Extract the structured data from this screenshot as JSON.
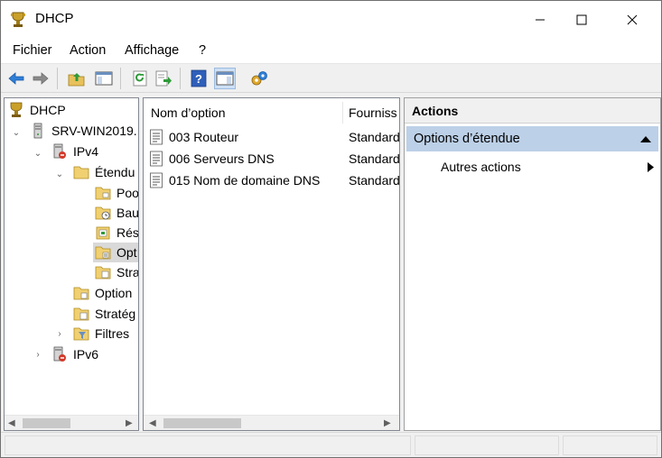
{
  "window": {
    "title": "DHCP",
    "icons": {
      "app": "dhcp-trophy-icon",
      "minimize": "minimize-icon",
      "maximize": "maximize-icon",
      "close": "close-icon"
    }
  },
  "menu": {
    "items": [
      "Fichier",
      "Action",
      "Affichage",
      "?"
    ]
  },
  "toolbar": {
    "buttons": [
      "back-icon",
      "forward-icon",
      "up-folder-icon",
      "show-hide-tree-icon",
      "refresh-icon",
      "export-list-icon",
      "help-icon",
      "show-hide-action-pane-icon",
      "dhcp-server-icon"
    ]
  },
  "tree": {
    "root": "DHCP",
    "server": "SRV-WIN2019.",
    "ipv4": "IPv4",
    "scope": "Étendu",
    "pool": "Poo",
    "leases": "Bau",
    "reservations": "Rés",
    "scope_options": "Opt",
    "policies": "Stra",
    "server_options": "Option",
    "server_policies": "Stratég",
    "filters": "Filtres",
    "ipv6": "IPv6"
  },
  "list": {
    "columns": [
      "Nom d’option",
      "Fourniss"
    ],
    "rows": [
      {
        "name": "003 Routeur",
        "vendor": "Standard"
      },
      {
        "name": "006 Serveurs DNS",
        "vendor": "Standard"
      },
      {
        "name": "015 Nom de domaine DNS",
        "vendor": "Standard"
      }
    ]
  },
  "actions": {
    "title": "Actions",
    "section": "Options d’étendue",
    "more": "Autres actions"
  },
  "colors": {
    "selection": "#bcd0e7",
    "tree_selected": "#d9d9d9"
  }
}
